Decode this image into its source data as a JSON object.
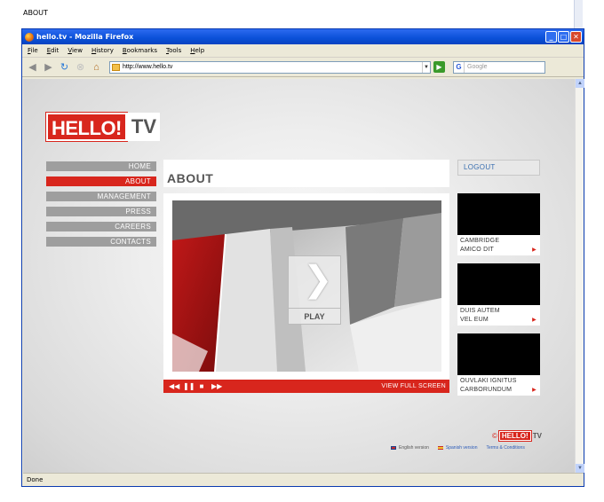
{
  "page_heading": "ABOUT",
  "browser": {
    "title": "hello.tv - Mozilla Firefox",
    "menu": [
      "File",
      "Edit",
      "View",
      "History",
      "Bookmarks",
      "Tools",
      "Help"
    ],
    "url": "http://www.hello.tv",
    "search_placeholder": "Google",
    "status": "Done"
  },
  "site": {
    "logo_hello": "HELLO!",
    "logo_tv": "TV",
    "nav": [
      {
        "label": "HOME",
        "active": false
      },
      {
        "label": "ABOUT",
        "active": true
      },
      {
        "label": "MANAGEMENT",
        "active": false
      },
      {
        "label": "PRESS",
        "active": false
      },
      {
        "label": "CAREERS",
        "active": false
      },
      {
        "label": "CONTACTS",
        "active": false
      }
    ],
    "section_title": "ABOUT",
    "player": {
      "play_label": "PLAY",
      "fullscreen_label": "VIEW FULL SCREEN"
    },
    "logout_label": "LOGOUT",
    "thumbnails": [
      {
        "line1": "CAMBRIDGE",
        "line2": "AMICO DIT"
      },
      {
        "line1": "DUIS AUTEM",
        "line2": "VEL EUM"
      },
      {
        "line1": "OUVLAKI IGNITUS",
        "line2": "CARBORUNDUM"
      }
    ],
    "footer": {
      "copyright_symbol": "©",
      "logo_hello": "HELLO!",
      "logo_tv": "TV",
      "english": "English version",
      "spanish": "Spanish version",
      "terms": "Terms & Conditions"
    }
  },
  "colors": {
    "brand_red": "#d8261d",
    "nav_grey": "#9e9e9e",
    "link_blue": "#3a6fb0"
  }
}
